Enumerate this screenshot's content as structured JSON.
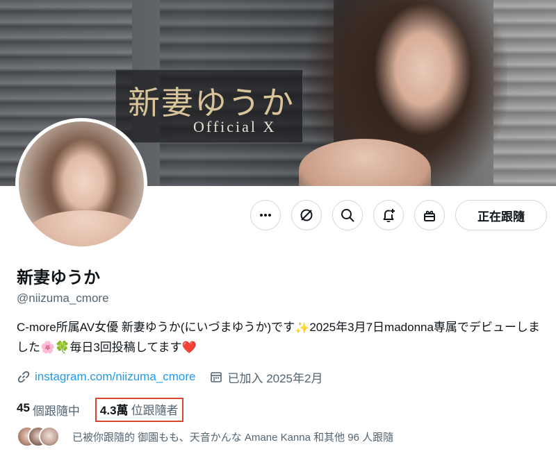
{
  "banner": {
    "title": "新妻ゆうか",
    "subtitle": "Official X"
  },
  "actions": {
    "more_icon": "more-horizontal-icon",
    "grok_icon": "grok-icon",
    "search_icon": "search-icon",
    "notify_icon": "bell-plus-icon",
    "gift_icon": "gift-icon",
    "follow_label": "正在跟隨"
  },
  "profile": {
    "display_name": "新妻ゆうか",
    "handle": "@niizuma_cmore",
    "bio_part1": "C-more所属AV女優 新妻ゆうか(にいづまゆうか)です",
    "bio_emoji1": "✨",
    "bio_part2": "2025年3月7日madonna専属でデビューしました",
    "bio_emoji2": "🌸",
    "bio_emoji3": "🍀",
    "bio_part3": "毎日3回投稿してます",
    "bio_emoji4": "❤️",
    "link": "instagram.com/niizuma_cmore",
    "joined": "已加入 2025年2月"
  },
  "stats": {
    "following_count": "45",
    "following_label": "個跟隨中",
    "followers_count": "4.3萬",
    "followers_label": "位跟隨者",
    "highlight_color": "#d9452e"
  },
  "followed_by": {
    "text": "已被你跟隨的 御園もも、天音かんな Amane Kanna 和其他 96 人跟隨"
  },
  "colors": {
    "link": "#1d9bf0",
    "secondary_text": "#536471",
    "border": "#cfd9de"
  }
}
